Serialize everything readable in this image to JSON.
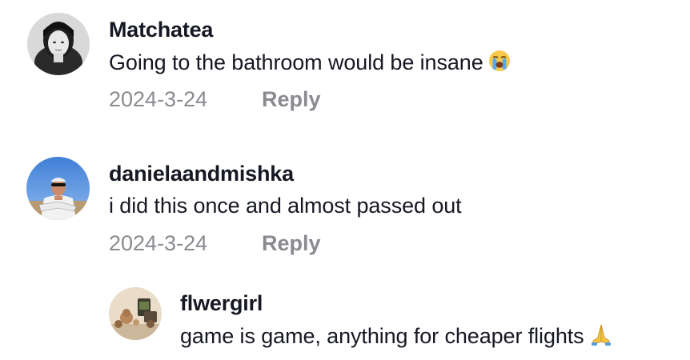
{
  "comments": [
    {
      "username": "Matchatea",
      "text": "Going to the bathroom would be insane",
      "emoji": "loudly-crying-face-icon",
      "date": "2024-3-24",
      "reply_label": "Reply"
    },
    {
      "username": "danielaandmishka",
      "text": "i did this once and almost passed out",
      "date": "2024-3-24",
      "reply_label": "Reply"
    }
  ],
  "replies": [
    {
      "username": "flwergirl",
      "text": "game is game, anything for cheaper flights",
      "emoji": "folded-hands-icon"
    }
  ],
  "colors": {
    "username": "#161823",
    "text": "#161823",
    "meta": "#8a8b91",
    "background": "#ffffff"
  }
}
